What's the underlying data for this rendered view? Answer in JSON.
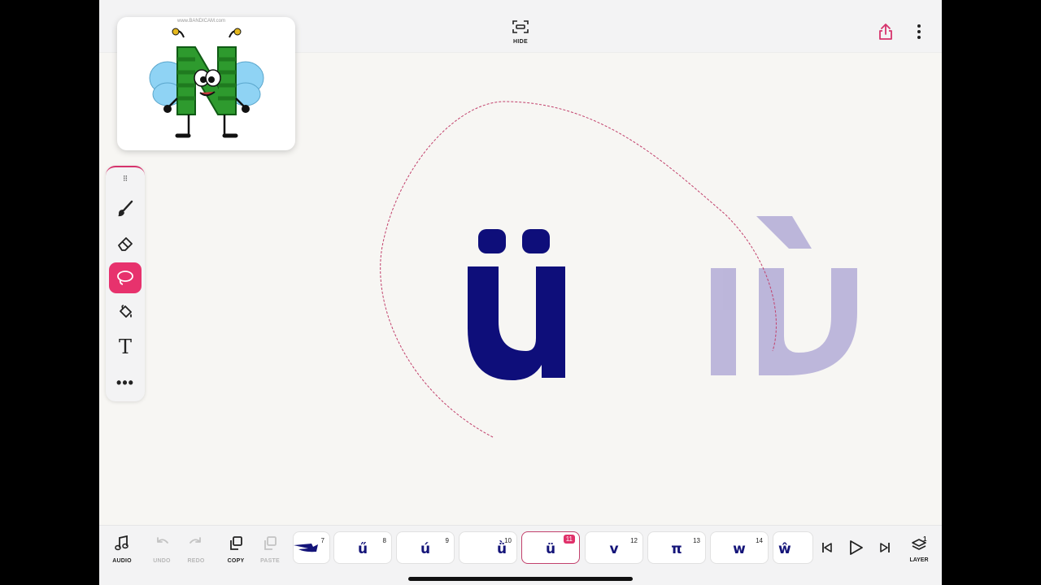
{
  "topbar": {
    "hide_label": "HIDE",
    "icons": [
      "hide-icon",
      "share-icon",
      "more-vertical-icon"
    ]
  },
  "thumbnail": {
    "watermark": "www.BANDICAM.com",
    "letter": "N",
    "colors": {
      "letter": "#2e9a2e",
      "wings": "#8fd3f4"
    }
  },
  "toolbox": {
    "tools": [
      {
        "name": "brush",
        "icon": "brush-icon",
        "active": false
      },
      {
        "name": "eraser",
        "icon": "eraser-icon",
        "active": false
      },
      {
        "name": "lasso",
        "icon": "lasso-icon",
        "active": true
      },
      {
        "name": "fill",
        "icon": "paint-bucket-icon",
        "active": false
      },
      {
        "name": "text",
        "icon": "text-icon",
        "glyph": "T",
        "active": false
      },
      {
        "name": "more",
        "icon": "more-horizontal-icon",
        "glyph": "•••",
        "active": false
      }
    ],
    "accent": "#e7326d"
  },
  "canvas": {
    "main_letter": "ü",
    "onion_letter": "ǜ",
    "colors": {
      "main": "#0e0e7a",
      "onion": "#b9b3d9",
      "lasso": "#c2416c"
    }
  },
  "bottombar": {
    "audio_label": "AUDIO",
    "undo_label": "UNDO",
    "redo_label": "REDO",
    "copy_label": "COPY",
    "paste_label": "PASTE",
    "layer_label": "LAYER",
    "layer_count": "1",
    "frames": [
      {
        "number": "7",
        "glyph": ""
      },
      {
        "number": "8",
        "glyph": "ű"
      },
      {
        "number": "9",
        "glyph": "ú"
      },
      {
        "number": "10",
        "glyph": "ǜ"
      },
      {
        "number": "11",
        "glyph": "ü",
        "active": true
      },
      {
        "number": "12",
        "glyph": "v"
      },
      {
        "number": "13",
        "glyph": "π"
      },
      {
        "number": "14",
        "glyph": "w"
      },
      {
        "number": "",
        "glyph": "ŵ"
      }
    ]
  }
}
